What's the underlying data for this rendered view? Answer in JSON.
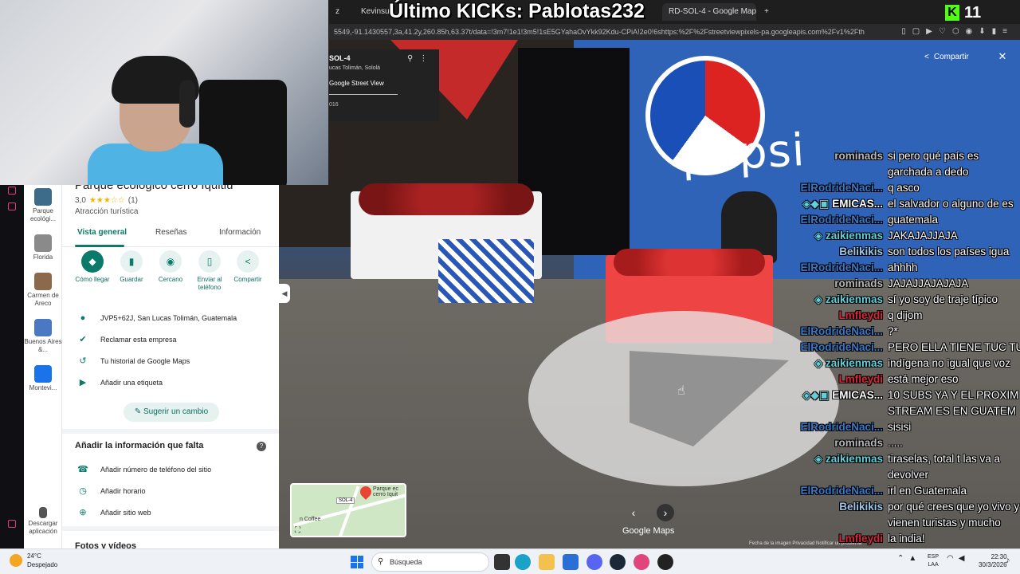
{
  "stream": {
    "title": "Último KICKs: Pablotas232",
    "kick_count": "11"
  },
  "browser": {
    "tabs": [
      "z",
      "Kevinsu",
      "RD-SOL-4 - Google Maps",
      "+"
    ],
    "active_tab": "RD-SOL-4 - Google Maps",
    "address": "5549,-91.1430557,3a,41.2y,260.85h,63.37t/data=!3m7!1e1!3m5!1sE5GYahaOvYkk92Kdu-CPiA!2e0!6shttps:%2F%2Fstreetviewpixels-pa.googleapis.com%2Fv1%2Fth"
  },
  "place": {
    "name": "Parque ecológico cerro Iquitiu",
    "rating": "3,0",
    "stars": "★★★☆☆",
    "review_count": "(1)",
    "category": "Atracción turística",
    "tabs": [
      "Vista general",
      "Reseñas",
      "Información"
    ],
    "actions": [
      {
        "label": "Cómo llegar",
        "icon": "◆"
      },
      {
        "label": "Guardar",
        "icon": "▮"
      },
      {
        "label": "Cercano",
        "icon": "◉"
      },
      {
        "label": "Enviar al teléfono",
        "icon": "▯"
      },
      {
        "label": "Compartir",
        "icon": "<"
      }
    ],
    "info": [
      {
        "icon": "●",
        "text": "JVP5+62J, San Lucas Tolimán, Guatemala"
      },
      {
        "icon": "✔",
        "text": "Reclamar esta empresa"
      },
      {
        "icon": "↺",
        "text": "Tu historial de Google Maps"
      },
      {
        "icon": "▶",
        "text": "Añadir una etiqueta"
      }
    ],
    "suggest_label": "Sugerir un cambio",
    "missing_title": "Añadir la información que falta",
    "missing": [
      {
        "icon": "☎",
        "text": "Añadir número de teléfono del sitio"
      },
      {
        "icon": "◷",
        "text": "Añadir horario"
      },
      {
        "icon": "⊕",
        "text": "Añadir sitio web"
      }
    ],
    "photos_title": "Fotos y vídeos"
  },
  "rail": [
    {
      "label": "Parque ecológi...",
      "color": "#3d6b8a"
    },
    {
      "label": "Florida",
      "color": "#8a8a8a"
    },
    {
      "label": "Carmen de Areco",
      "color": "#8a6a4a"
    },
    {
      "label": "Buenos Aires &...",
      "color": "#4a78c4"
    },
    {
      "label": "Montevi...",
      "color": "#1a73e8"
    }
  ],
  "rail_download": "Descargar aplicación",
  "street_view": {
    "title": "SOL-4",
    "subtitle": "ucas Tolimán, Sololá",
    "source": "Google Street View",
    "year": "016",
    "share_label": "Compartir",
    "brand": "Google Maps",
    "legal": "Fecha de la imagen   Privacidad   Notificar un problema"
  },
  "minimap": {
    "pin_label": "Parque ec cerro Iquit",
    "chip": "SOL-4",
    "coffee": "n Coffee"
  },
  "chat": [
    {
      "user": "rominads",
      "color": "#b7b7b7",
      "text": "si pero qué país es garchada a dedo"
    },
    {
      "user": "ElRodrideNaci...",
      "color": "#3a79c9",
      "text": "q asco"
    },
    {
      "user": "EMICAS...",
      "color": "#ffffff",
      "badges": "◈◆▣",
      "text": "el salvador o alguno de es"
    },
    {
      "user": "ElRodrideNaci...",
      "color": "#3a79c9",
      "text": "guatemala"
    },
    {
      "user": "zaikienmas",
      "color": "#5fd0d9",
      "badges": "◈",
      "text": "JAKAJAJJAJA"
    },
    {
      "user": "Belikikis",
      "color": "#9cc7ea",
      "text": "son todos los países igua"
    },
    {
      "user": "ElRodrideNaci...",
      "color": "#3a79c9",
      "text": "ahhhh"
    },
    {
      "user": "rominads",
      "color": "#b7b7b7",
      "text": "JAJAJJAJAJAJA"
    },
    {
      "user": "zaikienmas",
      "color": "#5fd0d9",
      "badges": "◈",
      "text": "sí yo soy de traje típico"
    },
    {
      "user": "Lmfleydi",
      "color": "#d9263a",
      "text": "q dijom"
    },
    {
      "user": "ElRodrideNaci...",
      "color": "#3a79c9",
      "text": "?*"
    },
    {
      "user": "ElRodrideNaci...",
      "color": "#3a79c9",
      "text": "PERO ELLA TIENE TUC TU"
    },
    {
      "user": "zaikienmas",
      "color": "#5fd0d9",
      "badges": "◈",
      "text": "indígena no igual que voz"
    },
    {
      "user": "Lmfleydi",
      "color": "#d9263a",
      "text": "está mejor eso"
    },
    {
      "user": "EMICAS...",
      "color": "#ffffff",
      "badges": "◈◆▣",
      "text": "10 SUBS YA Y EL PROXIM STREAM ES EN GUATEM"
    },
    {
      "user": "ElRodrideNaci...",
      "color": "#3a79c9",
      "text": "sisisi"
    },
    {
      "user": "rominads",
      "color": "#b7b7b7",
      "text": "....."
    },
    {
      "user": "zaikienmas",
      "color": "#5fd0d9",
      "badges": "◈",
      "text": "tiraselas, total t las va a devolver"
    },
    {
      "user": "ElRodrideNaci...",
      "color": "#3a79c9",
      "text": "irl en Guatemala"
    },
    {
      "user": "Belikikis",
      "color": "#9cc7ea",
      "text": "por qué crees que yo vivo y vienen turistas y mucho USA"
    },
    {
      "user": "Lmfleydi",
      "color": "#d9263a",
      "text": "la india!"
    },
    {
      "user": "ElRodrideNaci...",
      "color": "#3a79c9",
      "text": ""
    }
  ],
  "taskbar": {
    "temp": "24°C",
    "weather": "Despejado",
    "search_placeholder": "Búsqueda",
    "lang_line1": "ESP",
    "lang_line2": "LAA",
    "time": "22:30",
    "date": "30/3/2026"
  },
  "colors": {
    "maps_accent": "#0b7a6b",
    "kick_green": "#53fc18"
  }
}
